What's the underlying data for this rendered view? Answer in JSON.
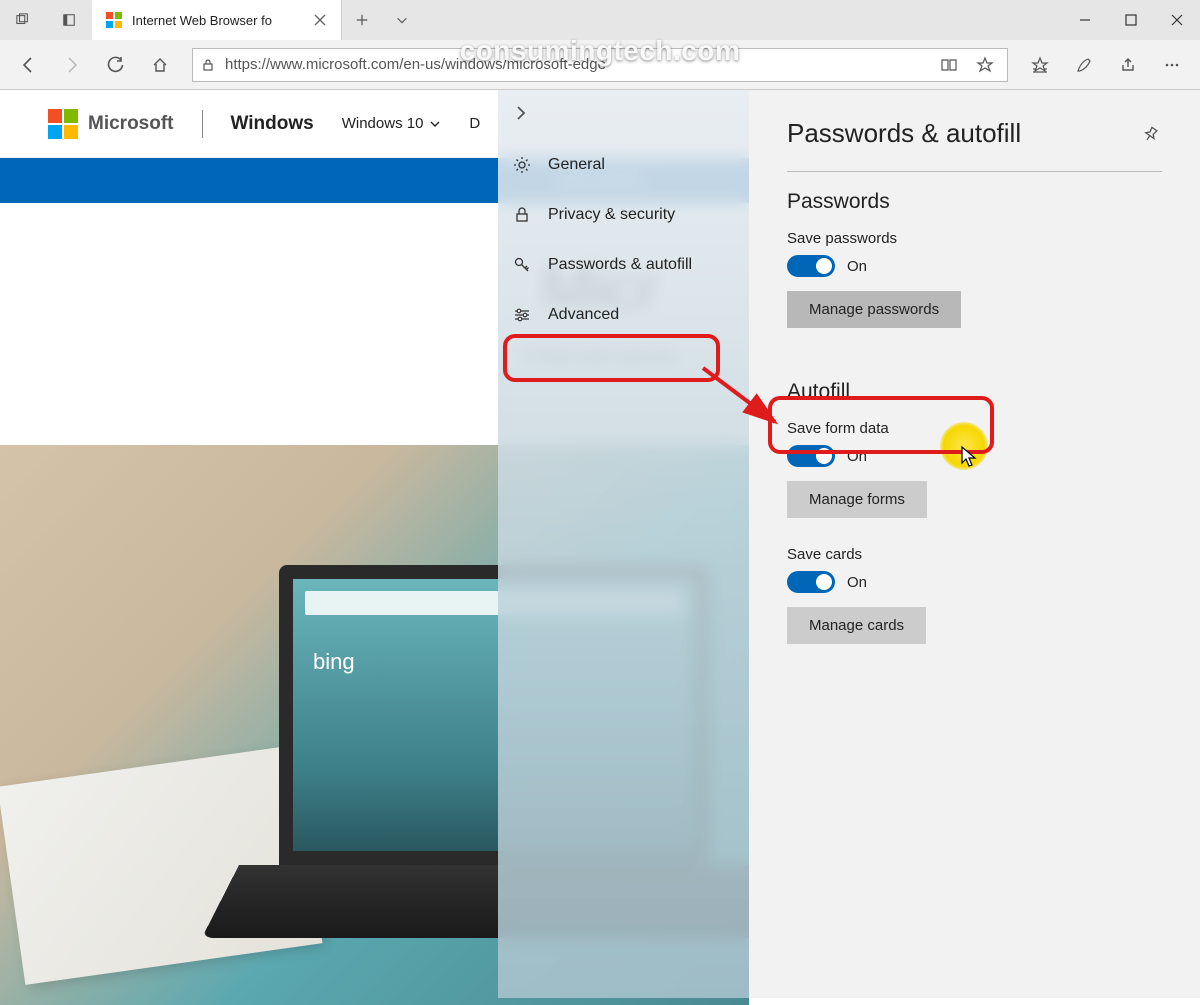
{
  "watermark": "consumingtech.com",
  "tab": {
    "title": "Internet Web Browser fo"
  },
  "url": "https://www.microsoft.com/en-us/windows/microsoft-edge",
  "ms_header": {
    "brand": "Microsoft",
    "section": "Windows",
    "menu1": "Windows 10",
    "menu2": "D"
  },
  "bluebar": "Shop Windo",
  "hero": {
    "title": "Micr",
    "subtitle": "A fast and secure"
  },
  "sidebar": {
    "items": [
      {
        "label": "General"
      },
      {
        "label": "Privacy & security"
      },
      {
        "label": "Passwords & autofill"
      },
      {
        "label": "Advanced"
      }
    ]
  },
  "panel": {
    "title": "Passwords & autofill",
    "passwords": {
      "heading": "Passwords",
      "save_label": "Save passwords",
      "toggle_state": "On",
      "manage_btn": "Manage passwords"
    },
    "autofill": {
      "heading": "Autofill",
      "formdata_label": "Save form data",
      "formdata_state": "On",
      "manage_forms_btn": "Manage forms",
      "cards_label": "Save cards",
      "cards_state": "On",
      "manage_cards_btn": "Manage cards"
    }
  },
  "laptop_screen": {
    "logo_text": "bing"
  }
}
